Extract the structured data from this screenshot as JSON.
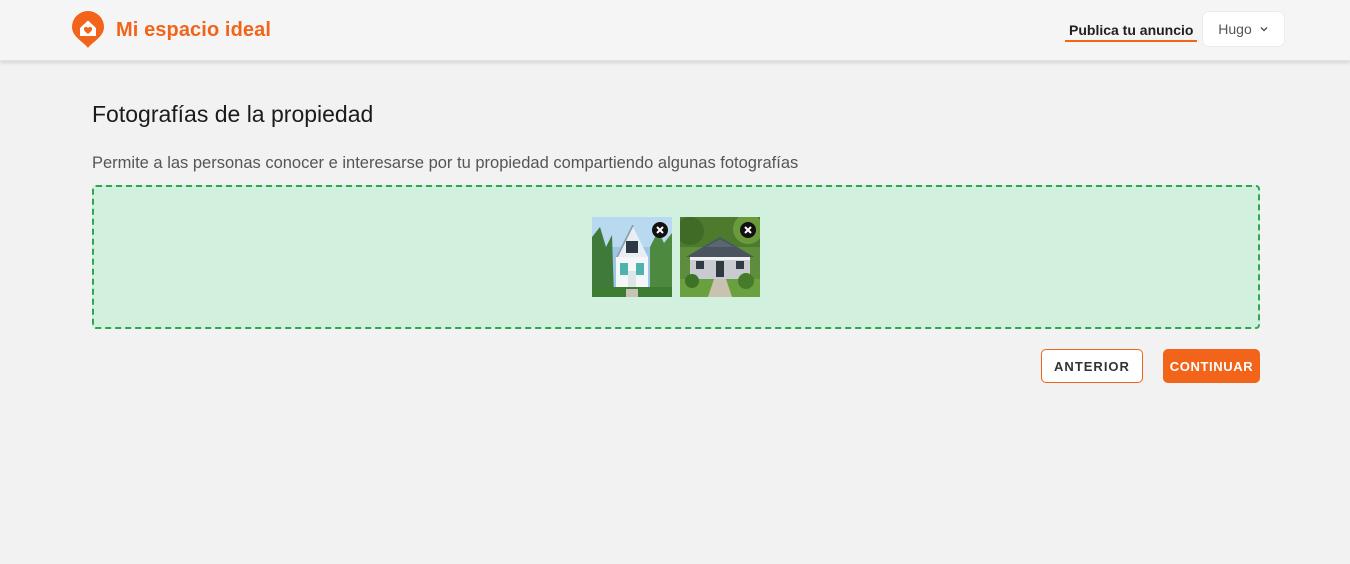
{
  "header": {
    "brand_name": "Mi espacio ideal",
    "brand_icon": "house-pin-icon",
    "publish_link": "Publica tu anuncio",
    "user_name": "Hugo",
    "accent_color": "#f26419"
  },
  "main": {
    "title": "Fotografías de la propiedad",
    "description": "Permite a las personas conocer e interesarse por tu propiedad compartiendo algunas fotografías",
    "photos": [
      {
        "icon": "white-cottage-photo",
        "remove_icon": "close-icon"
      },
      {
        "icon": "bungalow-photo",
        "remove_icon": "close-icon"
      }
    ],
    "dropzone_color": "#d1f0de"
  },
  "actions": {
    "previous_label": "ANTERIOR",
    "continue_label": "CONTINUAR"
  }
}
